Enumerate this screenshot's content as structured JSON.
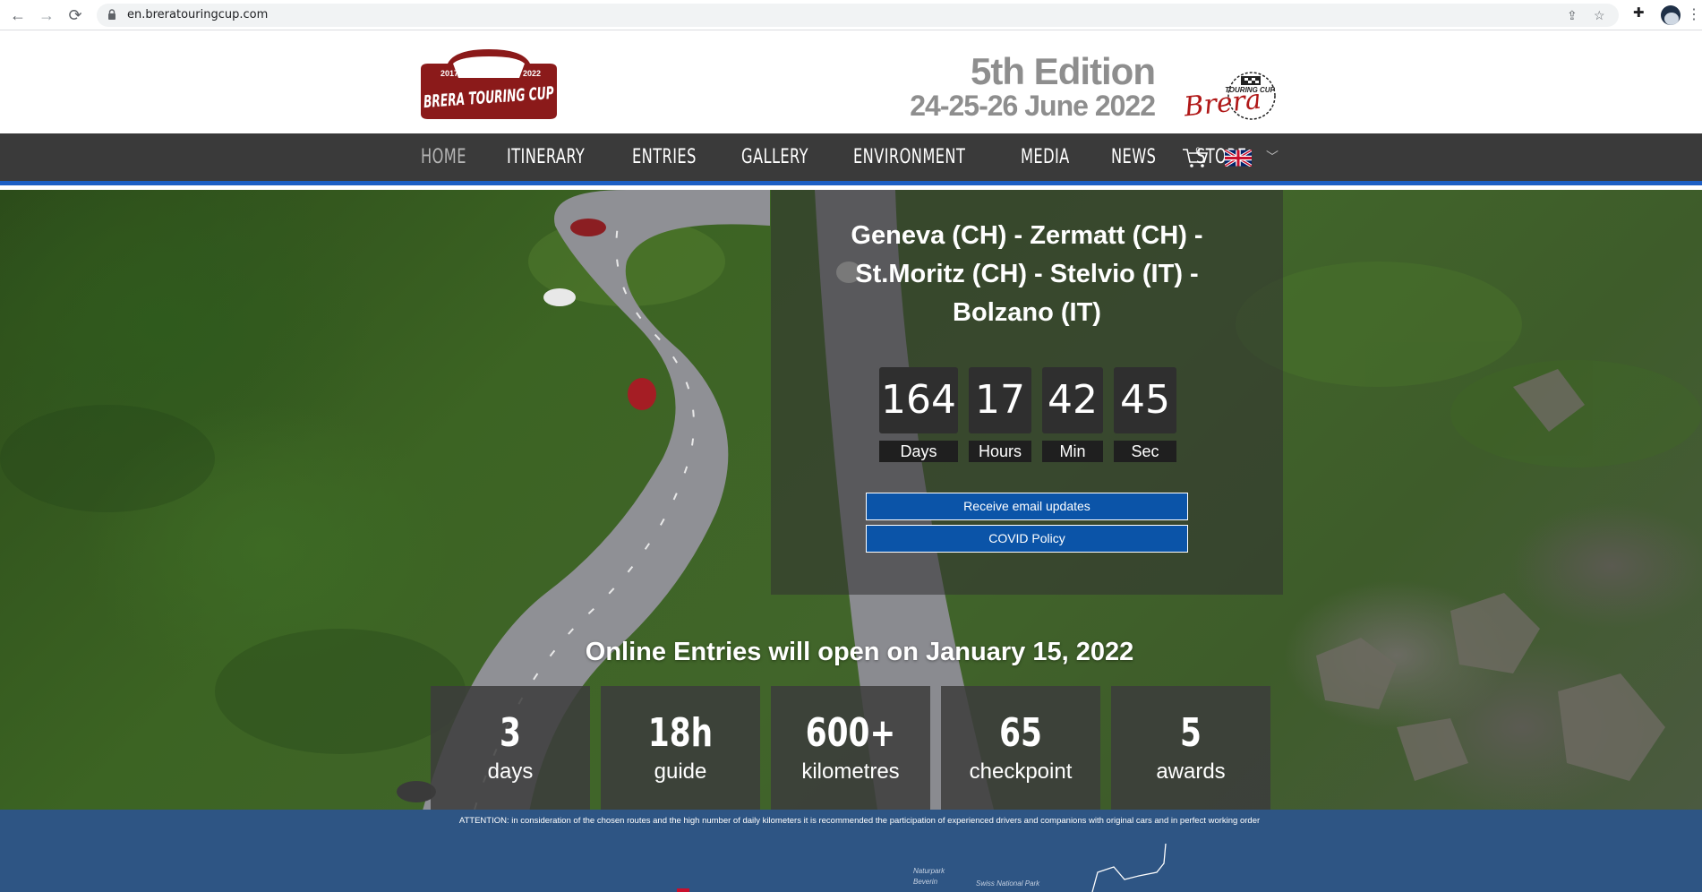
{
  "browser": {
    "url": "en.breratouringcup.com"
  },
  "header": {
    "logo": {
      "year_left": "2017",
      "year_right": "2022",
      "name": "BRERA TOURING CUP"
    },
    "edition": "5th Edition",
    "dates": "24-25-26 June 2022",
    "badge": {
      "top": "TOURING CUP",
      "script": "Brera"
    }
  },
  "nav": {
    "items": [
      {
        "label": "HOME",
        "active": true
      },
      {
        "label": "ITINERARY",
        "active": false
      },
      {
        "label": "ENTRIES",
        "active": false
      },
      {
        "label": "GALLERY",
        "active": false
      },
      {
        "label": "ENVIRONMENT",
        "active": false
      },
      {
        "label": "MEDIA",
        "active": false
      },
      {
        "label": "NEWS",
        "active": false
      },
      {
        "label": "STORE",
        "active": false
      }
    ],
    "cart_count": "0",
    "language_flag": "uk-flag-icon"
  },
  "hero": {
    "route_line1": "Geneva (CH) - Zermatt (CH) -",
    "route_line2": "St.Moritz (CH) - Stelvio (IT) -",
    "route_line3": "Bolzano (IT)",
    "countdown": {
      "days": {
        "value": "164",
        "label": "Days"
      },
      "hours": {
        "value": "17",
        "label": "Hours"
      },
      "min": {
        "value": "42",
        "label": "Min"
      },
      "sec": {
        "value": "45",
        "label": "Sec"
      }
    },
    "email_button": "Receive email updates",
    "covid_button": "COVID Policy",
    "entries_text": "Online Entries will open on January 15, 2022",
    "stats": [
      {
        "value": "3",
        "label": "days"
      },
      {
        "value": "18h",
        "label": "guide"
      },
      {
        "value": "600+",
        "label": "kilometres"
      },
      {
        "value": "65",
        "label": "checkpoint"
      },
      {
        "value": "5",
        "label": "awards"
      }
    ]
  },
  "footer_band": {
    "attention": "ATTENTION: in consideration of the chosen routes and the high number of daily kilometers it is recommended the participation of experienced drivers and companions with original cars and in perfect working order",
    "map_labels": [
      "Naturpark",
      "Beverin",
      "Swiss National Park"
    ]
  },
  "colors": {
    "accent_blue": "#1d5fc4",
    "button_blue": "#0b54a8",
    "logo_red": "#8b1a1a",
    "nav_bg": "#3a3a3a",
    "band_blue": "#2e5584"
  }
}
